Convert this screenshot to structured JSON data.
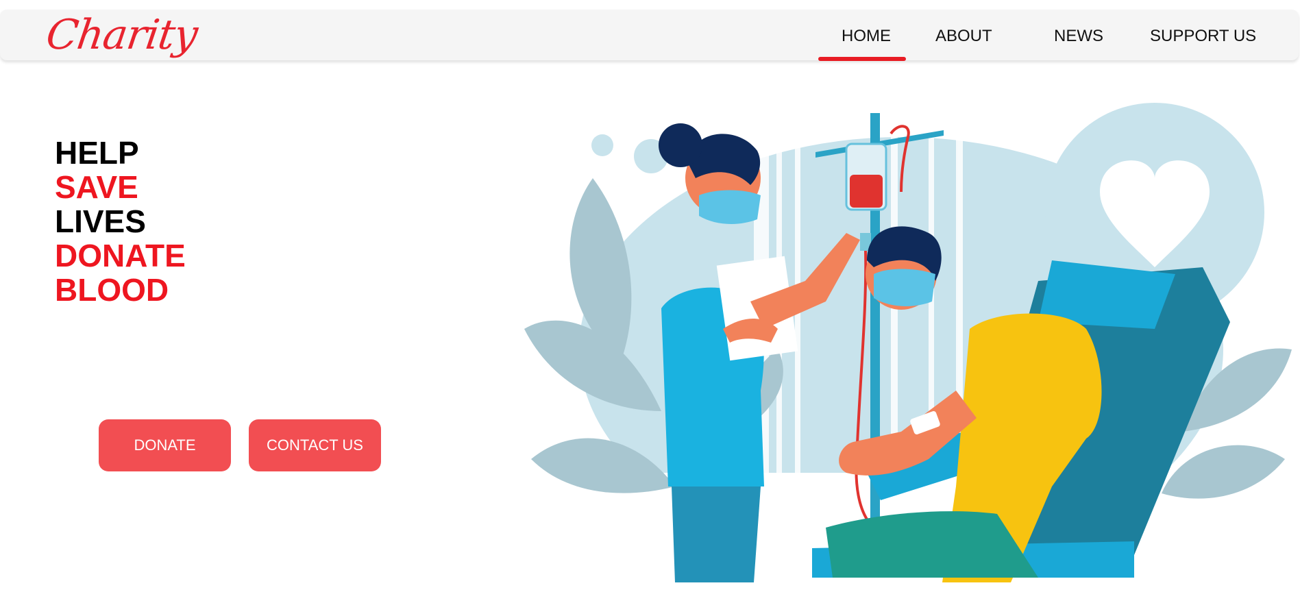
{
  "brand": {
    "name": "Charity"
  },
  "nav": {
    "items": [
      {
        "label": "HOME",
        "active": true
      },
      {
        "label": "ABOUT",
        "active": false
      },
      {
        "label": "NEWS",
        "active": false
      },
      {
        "label": "SUPPORT US",
        "active": false
      }
    ]
  },
  "hero": {
    "lines": [
      {
        "text": "HELP",
        "color": "black"
      },
      {
        "text": "SAVE",
        "color": "red"
      },
      {
        "text": "LIVES",
        "color": "black"
      },
      {
        "text": "DONATE",
        "color": "red"
      },
      {
        "text": "BLOOD",
        "color": "red"
      }
    ],
    "donate_label": "DONATE",
    "contact_label": "CONTACT US"
  },
  "illustration": {
    "subject": "nurse-assisting-blood-donor",
    "icons": [
      "heart-icon",
      "iv-drip-icon"
    ]
  },
  "colors": {
    "brand_red": "#e8242f",
    "button_red": "#f24e52",
    "navbar_bg": "#f5f5f5"
  }
}
